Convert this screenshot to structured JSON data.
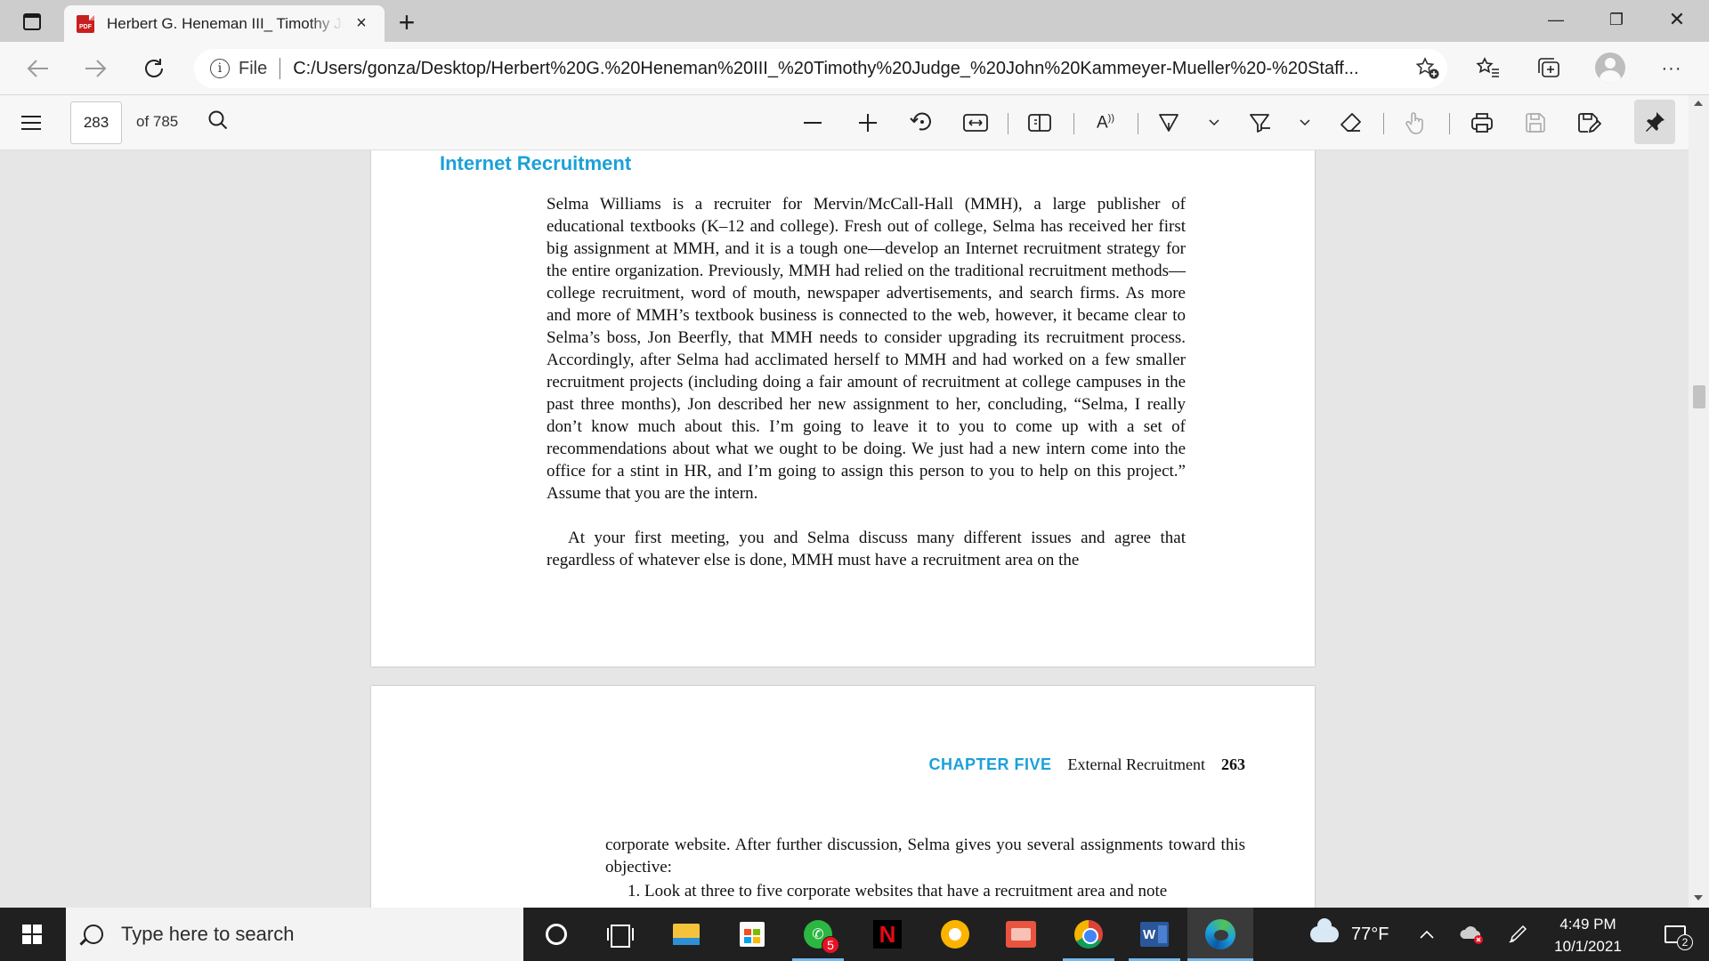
{
  "browser": {
    "tab": {
      "title": "Herbert G. Heneman III_ Timothy Judge_ John Kammeyer-Mueller",
      "favicon_text": "PDF"
    },
    "new_tab_label": "+",
    "window_controls": {
      "minimize": "—",
      "restore": "❐",
      "close": "✕"
    },
    "address": {
      "scheme_label": "File",
      "url": "C:/Users/gonza/Desktop/Herbert%20G.%20Heneman%20III_%20Timothy%20Judge_%20John%20Kammeyer-Mueller%20-%20Staff..."
    }
  },
  "pdf_toolbar": {
    "page_number": "283",
    "page_total": "of 785"
  },
  "document": {
    "section_heading": "Internet Recruitment",
    "paragraph_1": "Selma Williams is a recruiter for Mervin/McCall-Hall (MMH), a large publisher of educational textbooks (K–12 and college). Fresh out of college, Selma has received her first big assignment at MMH, and it is a tough one—develop an Internet recruitment strategy for the entire organization. Previously, MMH had relied on the traditional recruitment methods—college recruitment, word of mouth, newspaper advertisements, and search firms. As more and more of MMH’s textbook business is connected to the web, however, it became clear to Selma’s boss, Jon Beerfly, that MMH needs to consider upgrading its recruitment process. Accordingly, after Selma had acclimated herself to MMH and had worked on a few smaller recruitment projects (including doing a fair amount of recruitment at college campuses in the past three months), Jon described her new assignment to her, concluding, “Selma, I really don’t know much about this. I’m going to leave it to you to come up with a set of recommendations about what we ought to be doing. We just had a new intern come into the office for a stint in HR, and I’m going to assign this person to you to help on this project.” Assume that you are the intern.",
    "paragraph_2": "At your first meeting, you and Selma discuss many different issues and agree that regardless of whatever else is done, MMH must have a recruitment area on the",
    "running_header": {
      "chapter": "CHAPTER FIVE",
      "section": "External Recruitment",
      "page": "263"
    },
    "paragraph_3": "corporate website. After further discussion, Selma gives you several assignments toward this objective:",
    "list_item_1": "1. Look at three to five corporate websites that have a recruitment area and note"
  },
  "taskbar": {
    "search_placeholder": "Type here to search",
    "whatsapp_badge": "5",
    "netflix_letter": "N",
    "word_letter": "W",
    "temperature": "77°F",
    "time": "4:49 PM",
    "date": "10/1/2021",
    "notification_count": "2"
  },
  "colors": {
    "accent_heading": "#1ba1d8",
    "taskbar_bg": "#202020",
    "tab_strip_bg": "#cdcdcd"
  }
}
